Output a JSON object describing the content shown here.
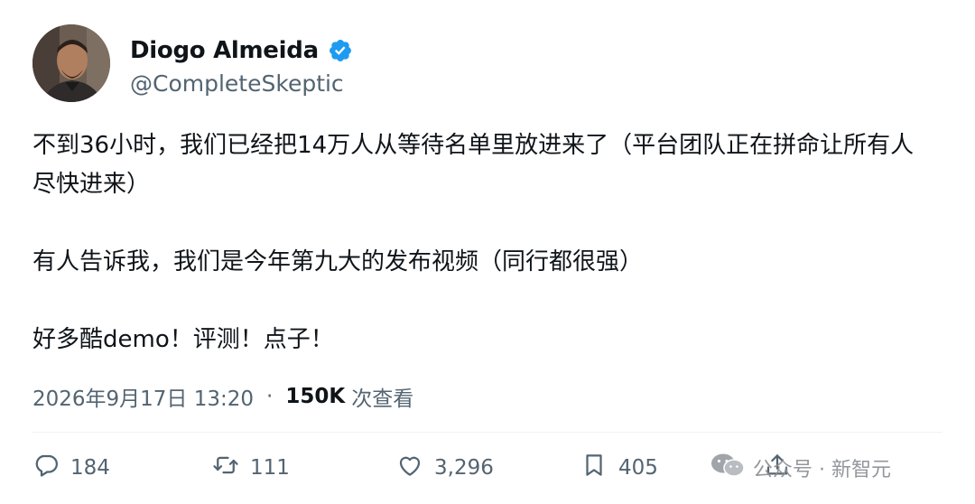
{
  "author": {
    "display_name": "Diogo Almeida",
    "handle": "@CompleteSkeptic",
    "verified": true,
    "verified_color": "#1d9bf0"
  },
  "tweet": {
    "paragraphs": [
      "不到36小时，我们已经把14万人从等待名单里放进来了（平台团队正在拼命让所有人尽快进来）",
      "有人告诉我，我们是今年第九大的发布视频（同行都很强）",
      "好多酷demo！评测！点子！"
    ],
    "timestamp": "2026年9月17日 13:20",
    "separator": "·",
    "views_count": "150K",
    "views_label": "次查看"
  },
  "actions": {
    "reply_count": "184",
    "retweet_count": "111",
    "like_count": "3,296",
    "bookmark_count": "405"
  },
  "watermark": {
    "text": "公众号 · 新智元"
  },
  "icons": {
    "verified": "verified-badge-icon",
    "reply": "reply-icon",
    "retweet": "retweet-icon",
    "like": "heart-icon",
    "bookmark": "bookmark-icon",
    "share": "share-icon",
    "watermark_logo": "wechat-icon"
  },
  "colors": {
    "text_primary": "#0f1419",
    "text_secondary": "#536471",
    "accent": "#1d9bf0"
  }
}
